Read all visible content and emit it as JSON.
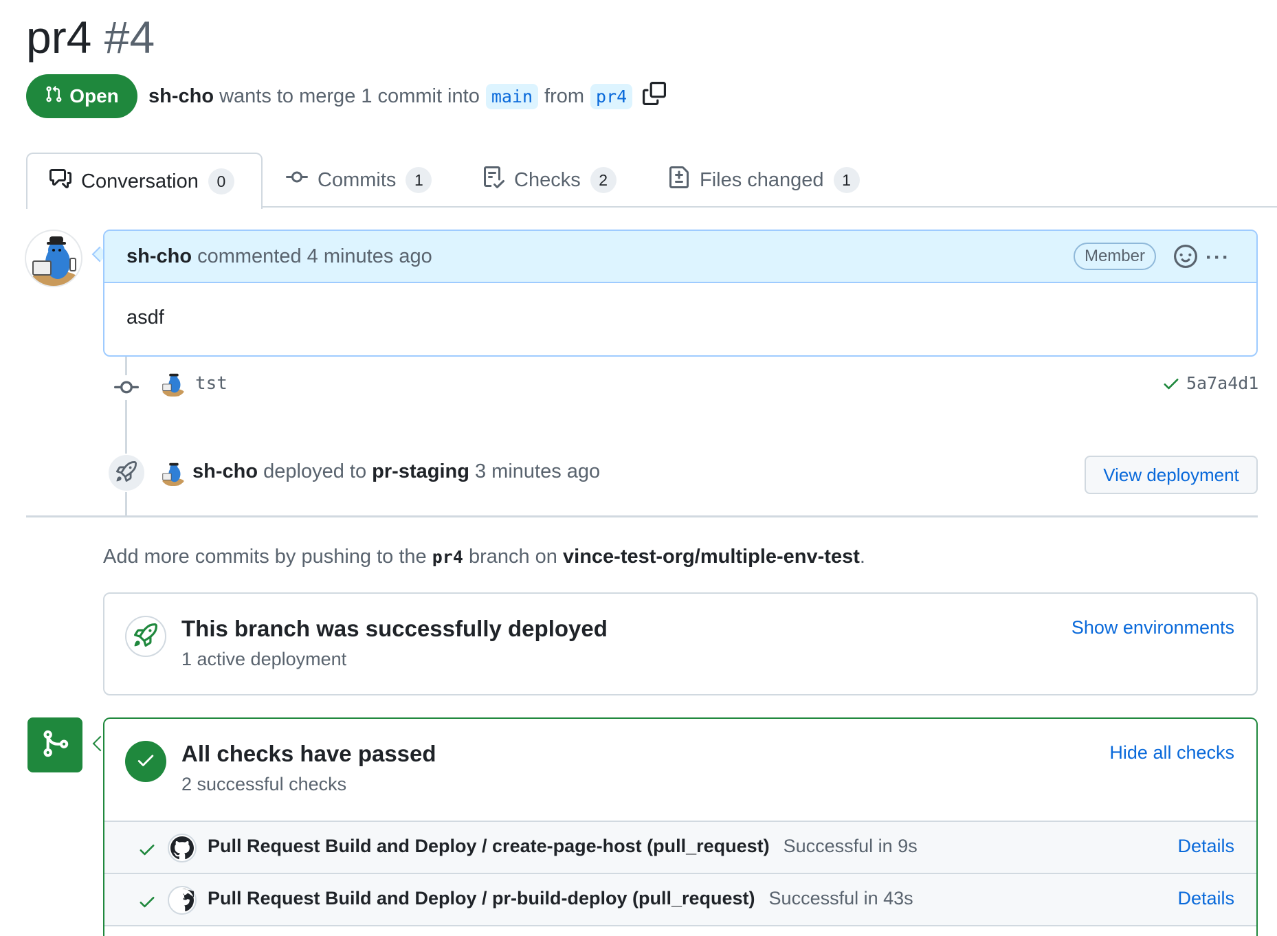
{
  "pr": {
    "title": "pr4",
    "number": "#4",
    "state": "Open",
    "author": "sh-cho",
    "merge_text": "wants to merge 1 commit into",
    "base_branch": "main",
    "from_text": "from",
    "head_branch": "pr4"
  },
  "tabs": [
    {
      "label": "Conversation",
      "count": "0",
      "icon": "comment-discussion-icon"
    },
    {
      "label": "Commits",
      "count": "1",
      "icon": "git-commit-icon"
    },
    {
      "label": "Checks",
      "count": "2",
      "icon": "checklist-icon"
    },
    {
      "label": "Files changed",
      "count": "1",
      "icon": "file-diff-icon"
    }
  ],
  "comment": {
    "author": "sh-cho",
    "action": "commented 4 minutes ago",
    "role_badge": "Member",
    "body": "asdf"
  },
  "commit": {
    "message": "tst",
    "sha": "5a7a4d1"
  },
  "deployment_event": {
    "author": "sh-cho",
    "action": "deployed to",
    "environment": "pr-staging",
    "time": "3 minutes ago",
    "button": "View deployment"
  },
  "push_note": {
    "prefix": "Add more commits by pushing to the",
    "branch": "pr4",
    "middle": "branch on",
    "repo": "vince-test-org/multiple-env-test",
    "suffix": "."
  },
  "deploy_box": {
    "title": "This branch was successfully deployed",
    "subtitle": "1 active deployment",
    "link": "Show environments"
  },
  "checks": {
    "title": "All checks have passed",
    "subtitle": "2 successful checks",
    "toggle": "Hide all checks",
    "rows": [
      {
        "name": "Pull Request Build and Deploy / create-page-host (pull_request)",
        "status": "Successful in 9s",
        "link": "Details"
      },
      {
        "name": "Pull Request Build and Deploy / pr-build-deploy (pull_request)",
        "status": "Successful in 43s",
        "link": "Details"
      }
    ]
  },
  "colors": {
    "success": "#1f883d",
    "link": "#0969da",
    "comment_header": "#ddf4ff"
  }
}
